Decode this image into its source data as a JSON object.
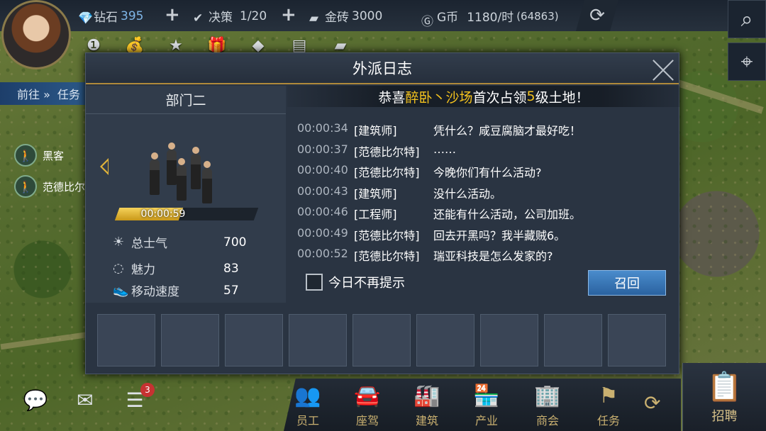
{
  "topbar": {
    "diamond_label": "钻石",
    "diamond_value": "395",
    "decision_label": "决策",
    "decision_value": "1/20",
    "gold_label": "金砖",
    "gold_value": "3000",
    "gcoin_label": "G币",
    "gcoin_rate": "1180/时",
    "gcoin_total": "(64863)"
  },
  "left_panel": {
    "goto_label": "前往 »",
    "task_label": "任务",
    "agents": [
      "黑客",
      "范德比尔"
    ]
  },
  "dialog": {
    "title": "外派日志",
    "department": "部门二",
    "progress_time": "00:00:59",
    "progress_fraction": 0.46,
    "stats": [
      {
        "label": "总士气",
        "value": "700"
      },
      {
        "label": "魅力",
        "value": "83"
      },
      {
        "label": "移动速度",
        "value": "57"
      }
    ],
    "congrats": {
      "prefix": "恭喜",
      "name": "醉卧丶沙场",
      "middle": "首次占领",
      "level": "5",
      "suffix": "级土地！"
    },
    "log": [
      {
        "time": "00:00:34",
        "name": "[建筑师]",
        "msg": "凭什么？咸豆腐脑才最好吃！"
      },
      {
        "time": "00:00:37",
        "name": "[范德比尔特]",
        "msg": "……"
      },
      {
        "time": "00:00:40",
        "name": "[范德比尔特]",
        "msg": "今晚你们有什么活动?"
      },
      {
        "time": "00:00:43",
        "name": "[建筑师]",
        "msg": "没什么活动。"
      },
      {
        "time": "00:00:46",
        "name": "[工程师]",
        "msg": "还能有什么活动，公司加班。"
      },
      {
        "time": "00:00:49",
        "name": "[范德比尔特]",
        "msg": "回去开黑吗？我半藏贼6。"
      },
      {
        "time": "00:00:52",
        "name": "[范德比尔特]",
        "msg": "瑞亚科技是怎么发家的?"
      }
    ],
    "checkbox_label": "今日不再提示",
    "recall_label": "召回"
  },
  "bottom": {
    "chat_badge": "3",
    "nav": [
      "员工",
      "座驾",
      "建筑",
      "产业",
      "商会",
      "任务"
    ],
    "recruit_label": "招聘"
  }
}
